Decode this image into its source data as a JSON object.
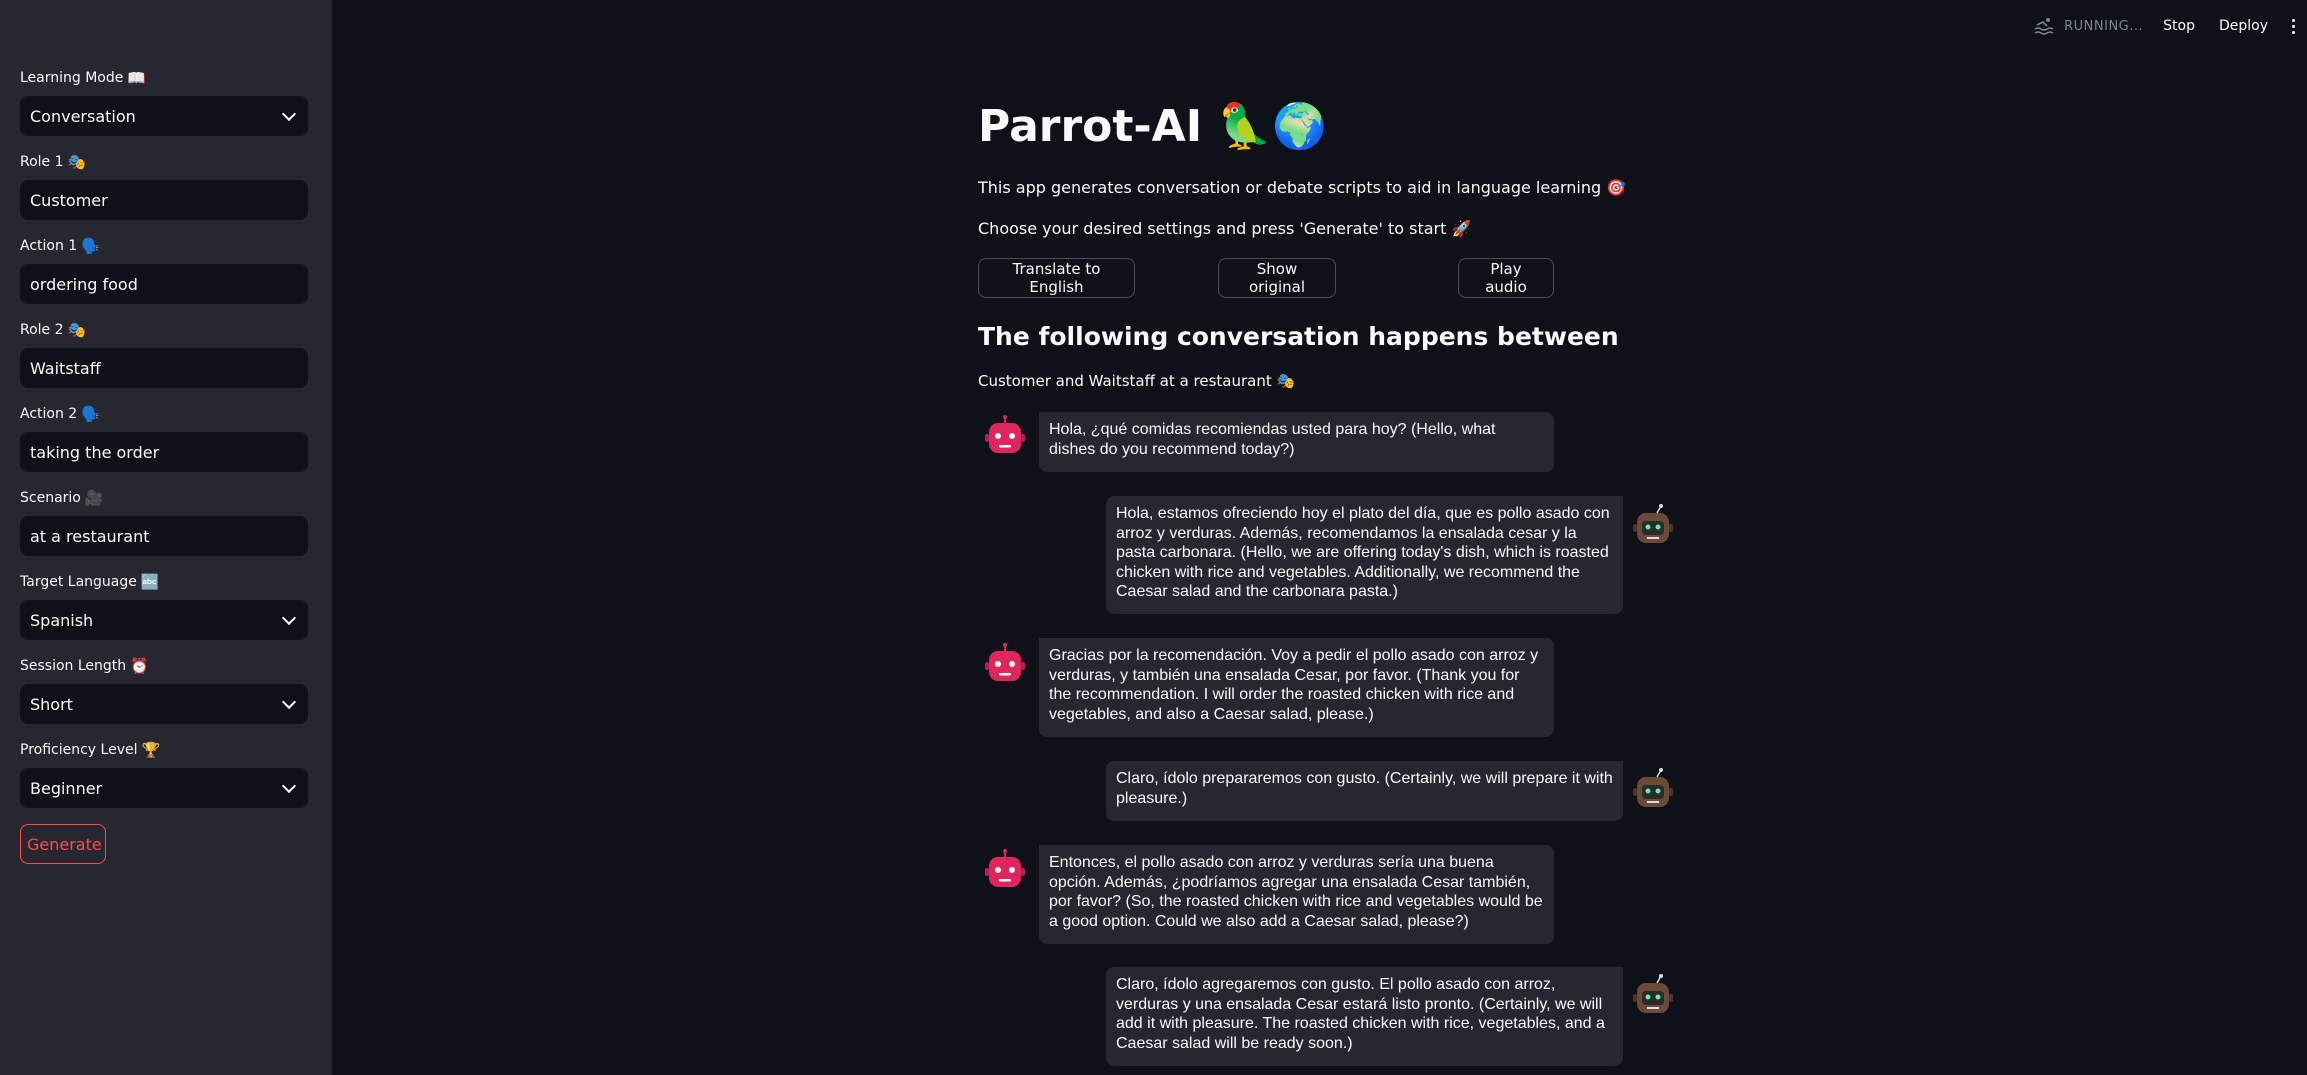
{
  "sidebar": {
    "fields": [
      {
        "label": "Learning Mode",
        "emoji": "📖",
        "value": "Conversation",
        "type": "select"
      },
      {
        "label": "Role 1",
        "emoji": "🎭",
        "value": "Customer",
        "type": "input"
      },
      {
        "label": "Action 1",
        "emoji": "🗣️",
        "value": "ordering food",
        "type": "input"
      },
      {
        "label": "Role 2",
        "emoji": "🎭",
        "value": "Waitstaff",
        "type": "input"
      },
      {
        "label": "Action 2",
        "emoji": "🗣️",
        "value": "taking the order",
        "type": "input"
      },
      {
        "label": "Scenario",
        "emoji": "🎥",
        "value": "at a restaurant",
        "type": "input"
      },
      {
        "label": "Target Language",
        "emoji": "🔤",
        "value": "Spanish",
        "type": "select"
      },
      {
        "label": "Session Length",
        "emoji": "⏰",
        "value": "Short",
        "type": "select"
      },
      {
        "label": "Proficiency Level",
        "emoji": "🏆",
        "value": "Beginner",
        "type": "select"
      }
    ],
    "generate_label": "Generate"
  },
  "header": {
    "status": "RUNNING...",
    "stop_label": "Stop",
    "deploy_label": "Deploy"
  },
  "main": {
    "title": "Parrot-AI 🦜🌍",
    "description": "This app generates conversation or debate scripts to aid in language learning 🎯",
    "instruction": "Choose your desired settings and press 'Generate' to start 🚀",
    "buttons": {
      "translate": "Translate to English",
      "show_original": "Show original",
      "play_audio": "Play audio"
    },
    "section_heading": "The following conversation happens between",
    "participants": "Customer and Waitstaff at a restaurant 🎭"
  },
  "messages": [
    {
      "speaker": "role1",
      "text": "Hola, ¿qué comidas recomiendas usted para hoy? (Hello, what dishes do you recommend today?)"
    },
    {
      "speaker": "role2",
      "text": "Hola, estamos ofreciendo hoy el plato del día, que es pollo asado con arroz y verduras. Además, recomendamos la ensalada cesar y la pasta carbonara. (Hello, we are offering today's dish, which is roasted chicken with rice and vegetables. Additionally, we recommend the Caesar salad and the carbonara pasta.)"
    },
    {
      "speaker": "role1",
      "text": "Gracias por la recomendación. Voy a pedir el pollo asado con arroz y verduras, y también una ensalada Cesar, por favor. (Thank you for the recommendation. I will order the roasted chicken with rice and vegetables, and also a Caesar salad, please.)"
    },
    {
      "speaker": "role2",
      "text": "Claro, ídolo prepararemos con gusto. (Certainly, we will prepare it with pleasure.)"
    },
    {
      "speaker": "role1",
      "text": "Entonces, el pollo asado con arroz y verduras sería una buena opción. Además, ¿podríamos agregar una ensalada Cesar también, por favor? (So, the roasted chicken with rice and vegetables would be a good option. Could we also add a Caesar salad, please?)"
    },
    {
      "speaker": "role2",
      "text": "Claro, ídolo agregaremos con gusto. El pollo asado con arroz, verduras y una ensalada Cesar estará listo pronto. (Certainly, we will add it with pleasure. The roasted chicken with rice, vegetables, and a Caesar salad will be ready soon.)"
    }
  ],
  "colors": {
    "background": "#0e1117",
    "sidebar": "#262730",
    "accent": "#ff4b4b",
    "bubble": "#262730",
    "avatar_role1": "#e0245e",
    "avatar_role2": "#6b4a3a"
  }
}
